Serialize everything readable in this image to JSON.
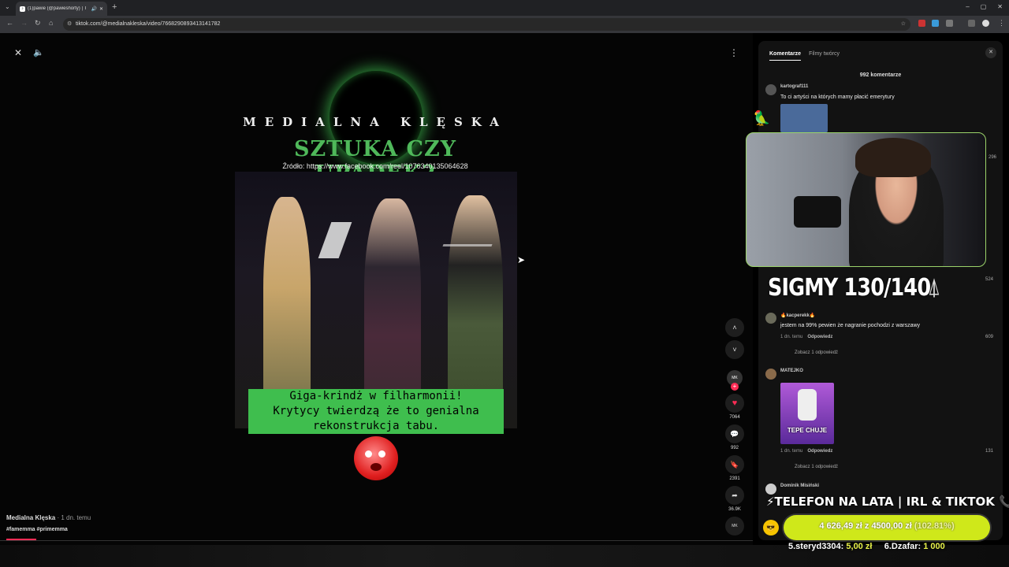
{
  "browser": {
    "tab_title": "(1)pawie (@pawieshorty) | T",
    "url": "tiktok.com/@medialnakleska/video/7668290893413141782",
    "window_controls": [
      "–",
      "▢",
      "✕"
    ]
  },
  "video": {
    "brand": "MEDIALNA KLĘSKA",
    "headline": "SZTUKA CZY UPADEK?",
    "source": "Źródło: https://www.facebook.com/reel/1076340135064628",
    "caption_lines": [
      "Giga-krindż w filharmonii!",
      "Krytycy twierdzą że to genialna",
      "rekonstrukcja tabu."
    ],
    "author": "Medialna Klęska",
    "time": " · 1 dn. temu",
    "tags": "#famemma #primemma",
    "progress": 0.04
  },
  "rail": {
    "avatar_label": "MK",
    "likes": "7064",
    "comments": "992",
    "saves": "2391",
    "shares": "36.9K"
  },
  "panel": {
    "tab_comments": "Komentarze",
    "tab_creator": "Filmy twórcy",
    "count": "992 komentarze",
    "comments": [
      {
        "user": "kartograf111",
        "text": "To ci artyści na których mamy płacić emerytury"
      },
      {
        "like": "296"
      },
      {
        "like": "524"
      },
      {
        "user": "🔥kacperekk🔥",
        "text": "jestem na 99% pewien że nagranie pochodzi z warszawy",
        "time": "1 dn. temu",
        "reply": "Odpowiedz",
        "like": "609",
        "more": "Zobacz 1 odpowiedź"
      },
      {
        "user": "MATEJKO",
        "thumb_text": "TEPE CHUJE",
        "time": "1 dn. temu",
        "reply": "Odpowiedz",
        "like": "131",
        "more": "Zobacz 1 odpowiedź"
      },
      {
        "user": "Dominik Misiński"
      }
    ]
  },
  "overlay": {
    "sigmy": "SIGMY 130/140",
    "ticker": "⚡TELEFON NA LATA | IRL & TIKTOK 📞",
    "goal_current": "4 626,49 zł",
    "goal_sep": " z ",
    "goal_target": "4500,00 zł",
    "goal_pct": " (102.81%)",
    "donor5_name": "5.steryd3304:",
    "donor5_amt": "5,00 zł",
    "donor6_name": "6.Dzafar:",
    "donor6_amt": "1 000"
  },
  "colors": {
    "accent": "#fe2c55",
    "headline": "#4fb85a",
    "caption_bg": "#3fbe4e",
    "goal_bar": "#cfe81a"
  }
}
